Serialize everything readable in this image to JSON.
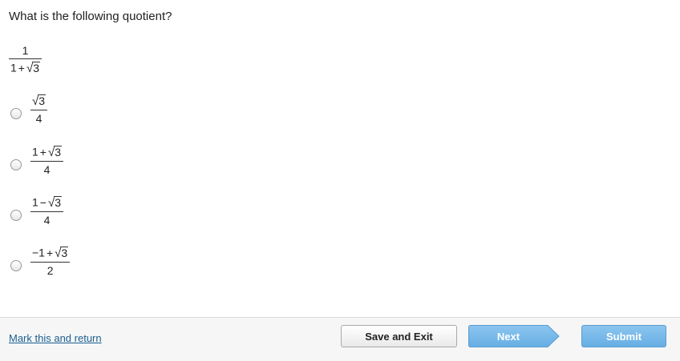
{
  "question": {
    "text": "What is the following quotient?",
    "prompt": {
      "numerator": "1",
      "den_prefix": "1",
      "den_operator": "+",
      "den_radicand": "3"
    }
  },
  "options": [
    {
      "num_prefix": "",
      "num_operator": "",
      "num_radicand": "3",
      "denominator": "4",
      "selected": false
    },
    {
      "num_prefix": "1",
      "num_operator": "+",
      "num_radicand": "3",
      "denominator": "4",
      "selected": false
    },
    {
      "num_prefix": "1",
      "num_operator": "−",
      "num_radicand": "3",
      "denominator": "4",
      "selected": false
    },
    {
      "num_prefix": "−1",
      "num_operator": "+",
      "num_radicand": "3",
      "denominator": "2",
      "selected": false
    }
  ],
  "sqrt_symbol": "√",
  "footer": {
    "mark_link": "Mark this and return",
    "save_label": "Save and Exit",
    "next_label": "Next",
    "submit_label": "Submit"
  },
  "colors": {
    "link": "#1a5f8f",
    "primary_button": "#66aee4",
    "footer_bg": "#f6f6f6"
  }
}
